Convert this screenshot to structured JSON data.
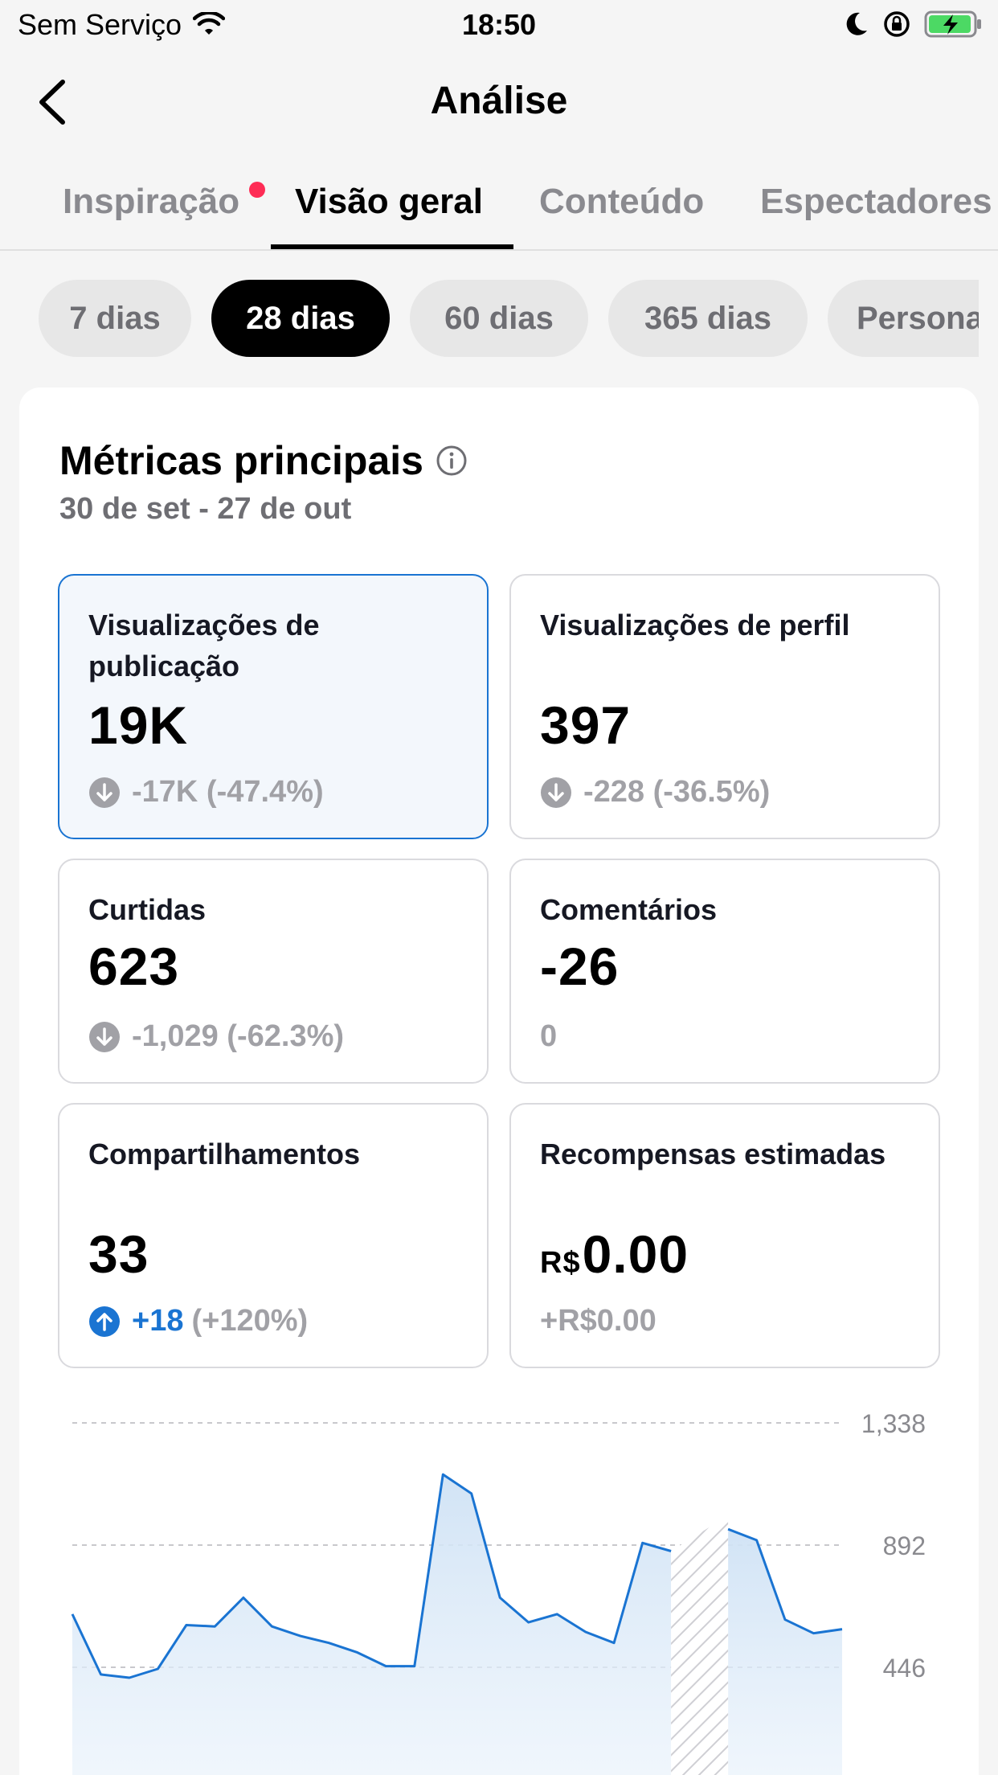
{
  "status_bar": {
    "carrier": "Sem Serviço",
    "time": "18:50",
    "colors": {
      "battery": "#4cd964"
    }
  },
  "header": {
    "title": "Análise"
  },
  "tabs": [
    {
      "label": "Inspiração",
      "active": false,
      "has_dot": true
    },
    {
      "label": "Visão geral",
      "active": true
    },
    {
      "label": "Conteúdo",
      "active": false
    },
    {
      "label": "Espectadores",
      "active": false
    }
  ],
  "date_ranges": [
    {
      "label": "7 dias",
      "active": false
    },
    {
      "label": "28 dias",
      "active": true
    },
    {
      "label": "60 dias",
      "active": false
    },
    {
      "label": "365 dias",
      "active": false
    },
    {
      "label": "Personalizado",
      "active": false
    }
  ],
  "metrics_section": {
    "title": "Métricas principais",
    "date_range": "30 de set - 27 de out",
    "cards": [
      {
        "label": "Visualizações de publicação",
        "value": "19K",
        "delta": "-17K (-47.4%)",
        "trend": "down",
        "selected": true
      },
      {
        "label": "Visualizações de perfil",
        "value": "397",
        "delta": "-228 (-36.5%)",
        "trend": "down"
      },
      {
        "label": "Curtidas",
        "value": "623",
        "delta": "-1,029 (-62.3%)",
        "trend": "down"
      },
      {
        "label": "Comentários",
        "value": "-26",
        "delta": "0",
        "trend": "none"
      },
      {
        "label": "Compartilhamentos",
        "value": "33",
        "delta_value": "+18",
        "delta_pct": "(+120%)",
        "trend": "up"
      },
      {
        "label": "Recompensas estimadas",
        "currency": "R$",
        "value": "0.00",
        "delta": "+R$0.00",
        "trend": "none"
      }
    ]
  },
  "chart_data": {
    "type": "area",
    "y_tick_labels": [
      "1,338",
      "892",
      "446"
    ],
    "yticks": [
      1338,
      892,
      446
    ],
    "ylim": [
      0,
      1338
    ],
    "grid": true,
    "series": [
      {
        "values": [
          640,
          420,
          408,
          440,
          600,
          595,
          700,
          595,
          560,
          535,
          500,
          450,
          450,
          1150,
          1080,
          700,
          610,
          640,
          575,
          535,
          900,
          870,
          null,
          950,
          910,
          620,
          570,
          585
        ]
      }
    ],
    "missing_band_indices": [
      21,
      23
    ],
    "colors": {
      "line": "#1a74d2",
      "fill": "#d6e6f6"
    }
  }
}
